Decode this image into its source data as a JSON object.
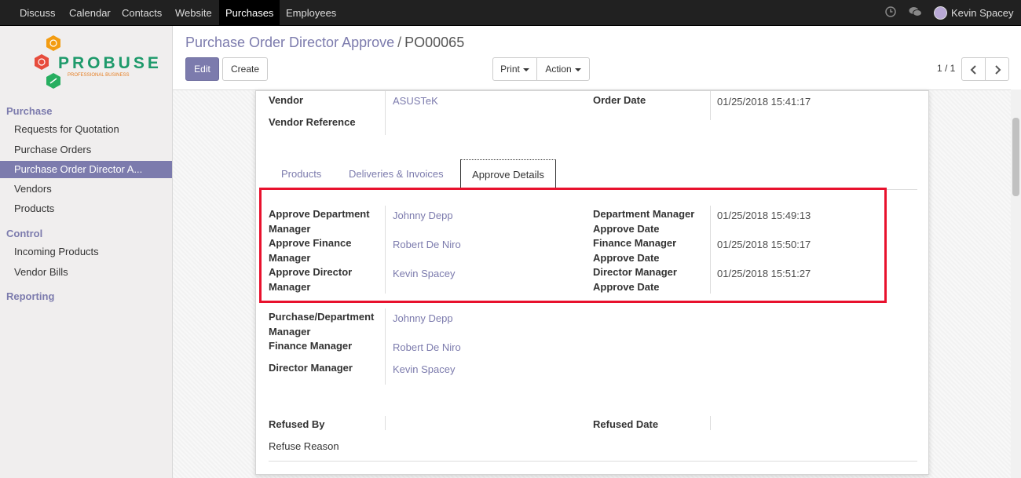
{
  "topbar": {
    "menus": [
      "Discuss",
      "Calendar",
      "Contacts",
      "Website",
      "Purchases",
      "Employees"
    ],
    "active": "Purchases",
    "user": "Kevin Spacey",
    "icons": [
      "clock-icon",
      "chat-icon"
    ]
  },
  "logo": {
    "text": "PROBUSE",
    "tagline": "PROFESSIONAL BUSINESS"
  },
  "sidebar": {
    "sections": [
      "Purchase",
      "Control",
      "Reporting"
    ],
    "purchase_items": [
      "Requests for Quotation",
      "Purchase Orders",
      "Purchase Order Director A...",
      "Vendors",
      "Products"
    ],
    "control_items": [
      "Incoming Products",
      "Vendor Bills"
    ]
  },
  "breadcrumb": {
    "parent": "Purchase Order Director Approve",
    "separator": "/",
    "current": "PO00065"
  },
  "buttons": {
    "edit": "Edit",
    "create": "Create",
    "print": "Print",
    "action": "Action"
  },
  "pager": "1 / 1",
  "form": {
    "vendor_label": "Vendor",
    "vendor": "ASUSTeK",
    "vendor_ref_label": "Vendor Reference",
    "order_date_label": "Order Date",
    "order_date": "01/25/2018 15:41:17",
    "tabs": [
      "Products",
      "Deliveries & Invoices",
      "Approve Details"
    ],
    "active_tab": "Approve Details",
    "approve_dept_label": "Approve Department Manager",
    "approve_dept": "Johnny Depp",
    "approve_fin_label": "Approve Finance Manager",
    "approve_fin": "Robert De Niro",
    "approve_dir_label": "Approve Director Manager",
    "approve_dir": "Kevin Spacey",
    "dept_date_label": "Department Manager Approve Date",
    "dept_date": "01/25/2018 15:49:13",
    "fin_date_label": "Finance Manager Approve Date",
    "fin_date": "01/25/2018 15:50:17",
    "dir_date_label": "Director Manager Approve Date",
    "dir_date": "01/25/2018 15:51:27",
    "pd_manager_label": "Purchase/Department Manager",
    "pd_manager": "Johnny Depp",
    "fin_manager_label": "Finance Manager",
    "fin_manager": "Robert De Niro",
    "dir_manager_label": "Director Manager",
    "dir_manager": "Kevin Spacey",
    "refused_by_label": "Refused By",
    "refused_date_label": "Refused Date",
    "refuse_reason_label": "Refuse Reason"
  }
}
